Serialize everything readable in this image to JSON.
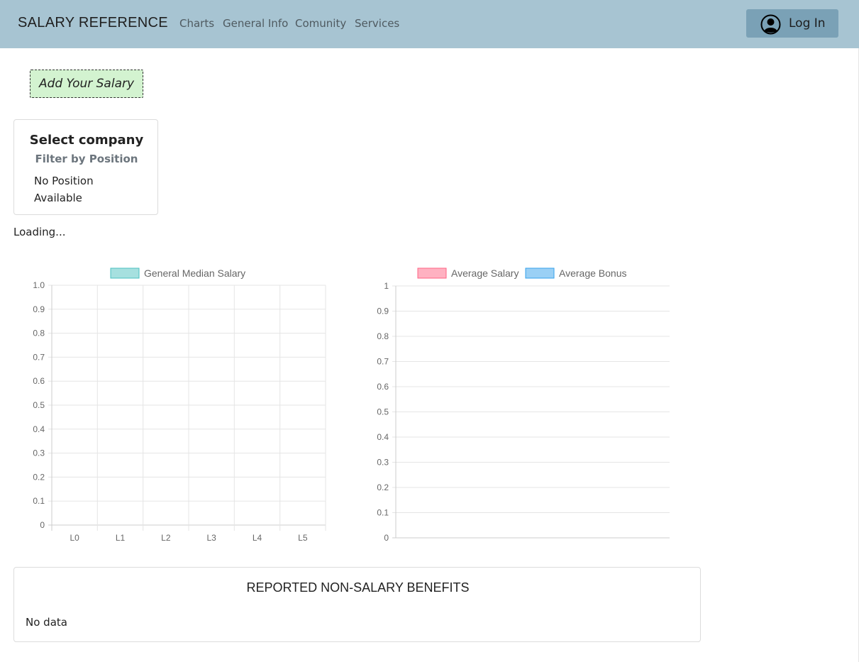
{
  "navbar": {
    "brand": "SALARY REFERENCE",
    "links": [
      "Charts",
      "General Info",
      "Comunity",
      "Services"
    ],
    "login_label": "Log In",
    "login_icon": "user-circle-icon",
    "background": "#a7c4d2",
    "button_color": "#7aa1b6"
  },
  "add_salary_label": "Add Your Salary",
  "company_filter": {
    "title": "Select company",
    "subtitle": "Filter by Position",
    "empty_text": "No Position Available"
  },
  "status_text": "Loading...",
  "chart_data": [
    {
      "type": "bar",
      "categories": [
        "L0",
        "L1",
        "L2",
        "L3",
        "L4",
        "L5"
      ],
      "series": [
        {
          "name": "General Median Salary",
          "values": [],
          "color": "#a6e0df"
        }
      ],
      "ylim": [
        0,
        1.0
      ],
      "y_ticks": [
        "1.0",
        "0.9",
        "0.8",
        "0.7",
        "0.6",
        "0.5",
        "0.4",
        "0.3",
        "0.2",
        "0.1",
        "0"
      ],
      "grid": true,
      "legend": "top"
    },
    {
      "type": "bar",
      "categories": [],
      "series": [
        {
          "name": "Average Salary",
          "values": [],
          "color": "#ffb1c1"
        },
        {
          "name": "Average Bonus",
          "values": [],
          "color": "#9ad0f5"
        }
      ],
      "ylim": [
        0,
        1
      ],
      "y_ticks": [
        "1",
        "0.9",
        "0.8",
        "0.7",
        "0.6",
        "0.5",
        "0.4",
        "0.3",
        "0.2",
        "0.1",
        "0"
      ],
      "grid": true,
      "legend": "top"
    }
  ],
  "benefits": {
    "title": "REPORTED NON-SALARY BENEFITS",
    "empty_text": "No data"
  }
}
